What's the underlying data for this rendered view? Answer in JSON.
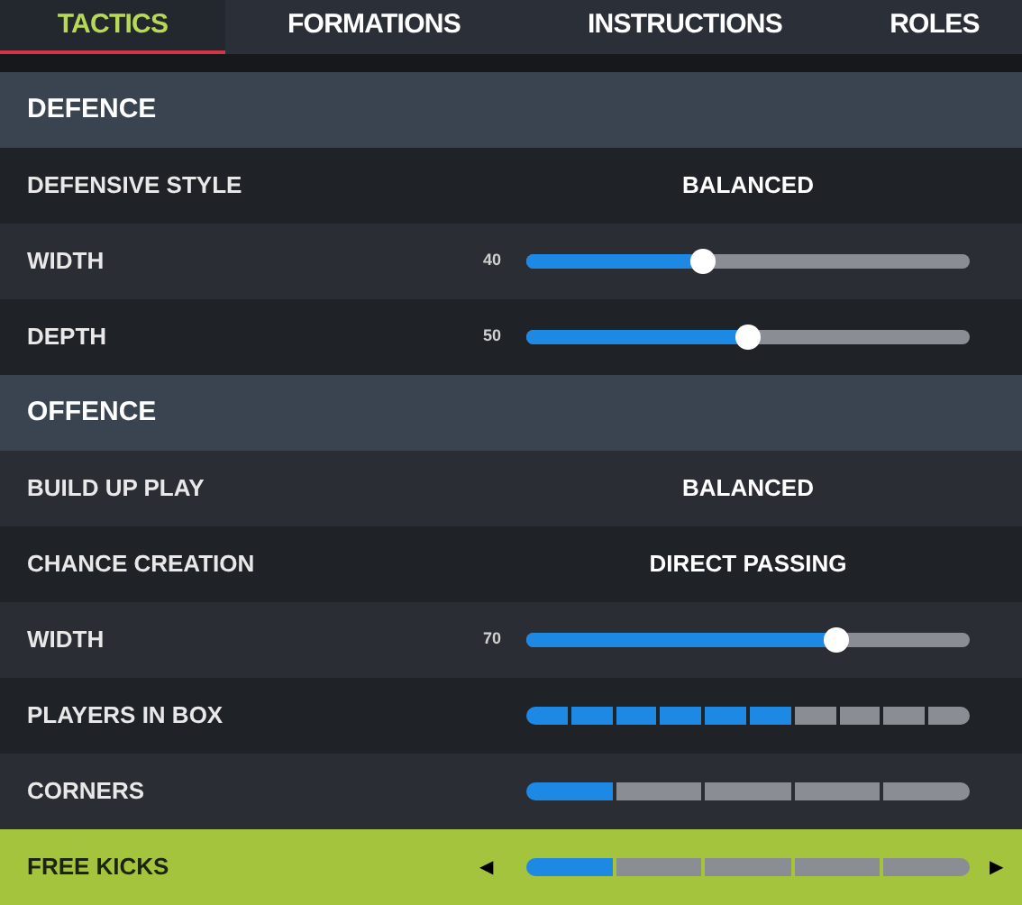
{
  "tabs": [
    {
      "label": "TACTICS",
      "selected": true
    },
    {
      "label": "FORMATIONS",
      "selected": false
    },
    {
      "label": "INSTRUCTIONS",
      "selected": false
    },
    {
      "label": "ROLES",
      "selected": false
    }
  ],
  "sections": [
    {
      "heading": "DEFENCE",
      "rows": [
        {
          "kind": "choice",
          "label": "DEFENSIVE STYLE",
          "value": "BALANCED",
          "selected": false
        },
        {
          "kind": "slider",
          "label": "WIDTH",
          "reading": "40",
          "level": 0.4,
          "selected": false
        },
        {
          "kind": "slider",
          "label": "DEPTH",
          "reading": "50",
          "level": 0.5,
          "selected": false
        }
      ]
    },
    {
      "heading": "OFFENCE",
      "rows": [
        {
          "kind": "choice",
          "label": "BUILD UP PLAY",
          "value": "BALANCED",
          "selected": false
        },
        {
          "kind": "choice",
          "label": "CHANCE CREATION",
          "value": "DIRECT PASSING",
          "selected": false
        },
        {
          "kind": "slider",
          "label": "WIDTH",
          "reading": "70",
          "level": 0.7,
          "selected": false
        },
        {
          "kind": "ticks",
          "label": "PLAYERS IN BOX",
          "level": 0.6,
          "selected": false
        },
        {
          "kind": "steps",
          "label": "CORNERS",
          "level": 0.2,
          "selected": false
        },
        {
          "kind": "steps",
          "label": "FREE KICKS",
          "level": 0.2,
          "selected": true,
          "left_arrow": "◀",
          "right_arrow": "▶"
        }
      ]
    }
  ]
}
